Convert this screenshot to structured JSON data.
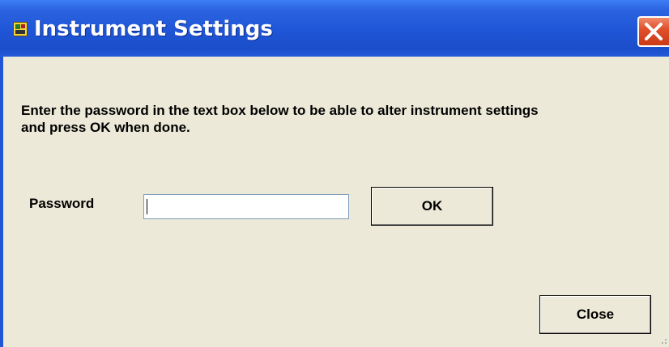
{
  "window": {
    "title": "Instrument Settings",
    "icon": "instrument-app-icon",
    "close_icon": "close-x-icon"
  },
  "dialog": {
    "instructions": "Enter the password in the text box below to be able to alter instrument settings and press OK when done.",
    "password_label": "Password",
    "password_value": "",
    "ok_label": "OK",
    "close_label": "Close"
  },
  "colors": {
    "titlebar": "#1f55d6",
    "client_background": "#ece9d8",
    "close_button": "#e0502c"
  }
}
